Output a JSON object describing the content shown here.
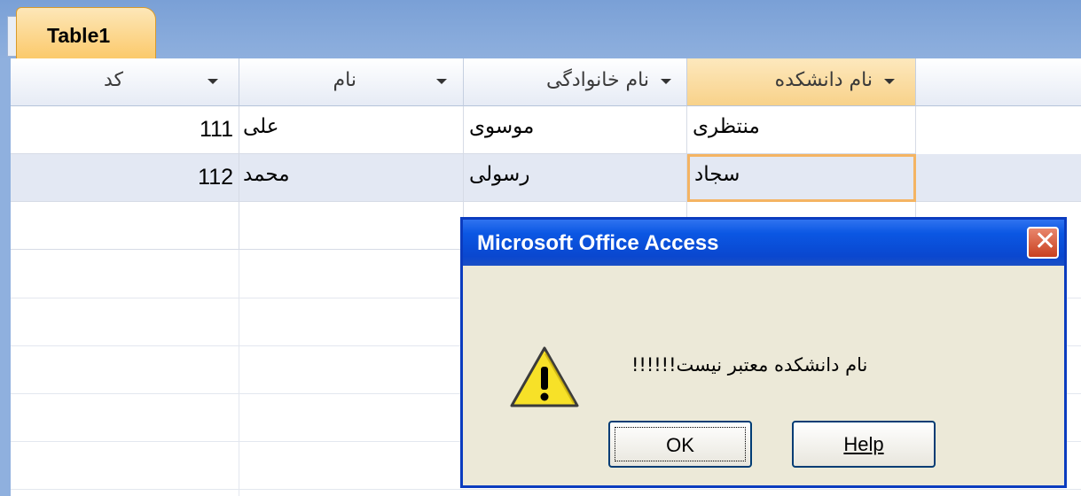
{
  "tab": {
    "title": "Table1"
  },
  "grid": {
    "columns": [
      "کد",
      "نام",
      "نام خانوادگی",
      "نام دانشکده"
    ],
    "rows": [
      {
        "code": "111",
        "name": "علی",
        "family": "موسوی",
        "faculty": "منتظری"
      },
      {
        "code": "112",
        "name": "محمد",
        "family": "رسولی",
        "faculty": "سجاد"
      }
    ]
  },
  "dialog": {
    "title": "Microsoft Office Access",
    "message": "!!!!!!نام دانشکده معتبر نیست",
    "ok_label": "OK",
    "help_label": "Help",
    "close_symbol": "✕"
  },
  "icons": {
    "warning": "warning-icon",
    "close": "close-icon",
    "dropdown": "chevron-down-icon"
  },
  "colors": {
    "accent": "#0a47cf",
    "tab": "#fbc96a",
    "focus": "#f4b463"
  }
}
